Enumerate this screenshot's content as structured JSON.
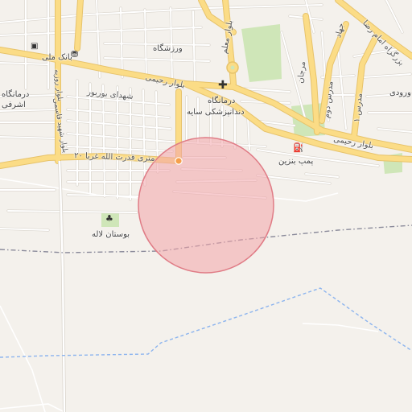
{
  "labels": {
    "varzeshgah": "ورزشگاه",
    "bank_melli": "بانک ملی",
    "darmangah_ashrafi_1": "درمانگاه",
    "darmangah_ashrafi_2": "اشرفی",
    "blvd_rahimi_left": "بلوار رحیمی",
    "shohada_burvar": "شهدای بوربور",
    "darmangah_sayeh_1": "درمانگاه",
    "darmangah_sayeh_2": "دندانپزشکی سایه",
    "blvd_rahimi_right": "بلوار رحیمی",
    "pomp_benzin": "پمپ بنزین",
    "bostan_laleh": "بوستان لاله",
    "street_20m_ghodrat": "۲۰ متری قدرت الله غربا",
    "blvd_moallem": "بلوار معلم",
    "blvd_shahid_hafez": "بلوار شهید قاسمی",
    "blvd_roozbeh": "بلوار روزبه",
    "bozorgrah_imam_reza": "بزرگراه امام رضا",
    "vorudi": "ورودی",
    "mardan": "مرجان",
    "modares_dovom": "مدرس دوم",
    "modares_1": "مدرس ۱",
    "jahad": "جهاد"
  },
  "icons": {
    "atm": "atm-icon",
    "bank": "bank-icon",
    "hospital": "hospital-cross-icon",
    "fuel": "fuel-pump-icon",
    "park": "park-tree-icon",
    "roundabout": "roundabout-icon",
    "marker": "location-marker-icon"
  },
  "colors": {
    "background": "#f4f1ec",
    "major_road": "#fbdc86",
    "major_road_casing": "#e7c36b",
    "minor_road": "#ffffff",
    "minor_road_casing": "#d9d4cc",
    "park": "#cfe6b8",
    "circle_fill": "#f2a4aa",
    "circle_stroke": "#e07c86",
    "boundary": "#8a8a9a",
    "waterway": "#8cb4ee"
  }
}
